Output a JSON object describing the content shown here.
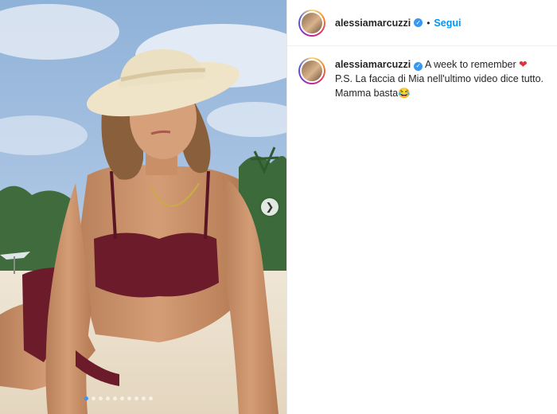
{
  "post": {
    "username": "alessiamarcuzzi",
    "follow_label": "Segui",
    "separator": "•",
    "verified_icon": "verified-badge-icon",
    "caption": {
      "line1": "A week to remember",
      "line1_emoji": "❤",
      "line2": "P.S. La faccia di Mia nell'ultimo video dice tutto.",
      "line3": "Mamma basta",
      "line3_emoji": "😂"
    },
    "carousel": {
      "total_slides": 10,
      "current_slide": 1,
      "next_icon": "chevron-right-icon"
    }
  },
  "colors": {
    "accent": "#0095f6",
    "verified": "#3897f0",
    "heart": "#e0303b"
  }
}
